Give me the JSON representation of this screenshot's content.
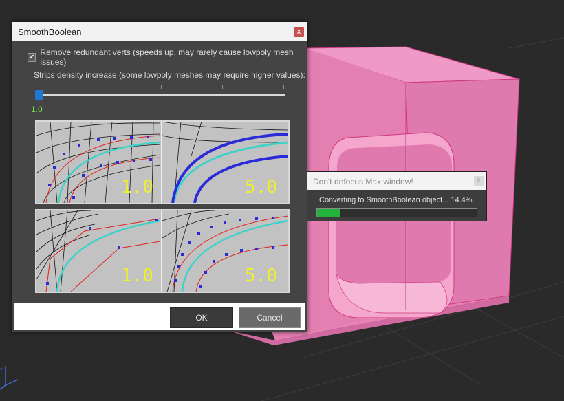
{
  "dialog": {
    "title": "SmoothBoolean",
    "close_glyph": "x",
    "remove_redundant": {
      "checked": true,
      "label": "Remove redundant verts (speeds up, may rarely cause lowpoly mesh issues)"
    },
    "strips_label": "Strips density increase (some lowpoly meshes may require higher values):",
    "slider": {
      "value_text": "1.0",
      "level_fraction": 0.0
    },
    "previews": [
      {
        "left_label": "1.0",
        "right_label": "5.0"
      },
      {
        "left_label": "1.0",
        "right_label": "5.0"
      }
    ],
    "ok_label": "OK",
    "cancel_label": "Cancel"
  },
  "progress_window": {
    "title": "Don't defocus Max window!",
    "status": "Converting to SmoothBoolean object... 14.4%",
    "progress_fraction": 0.144
  },
  "colors": {
    "mesh_pink": "#e882b4",
    "accent_blue": "#1e78d6",
    "progress_green": "#22b33a",
    "value_green": "#7ae04a",
    "preview_label_yellow": "#f0f02a"
  }
}
